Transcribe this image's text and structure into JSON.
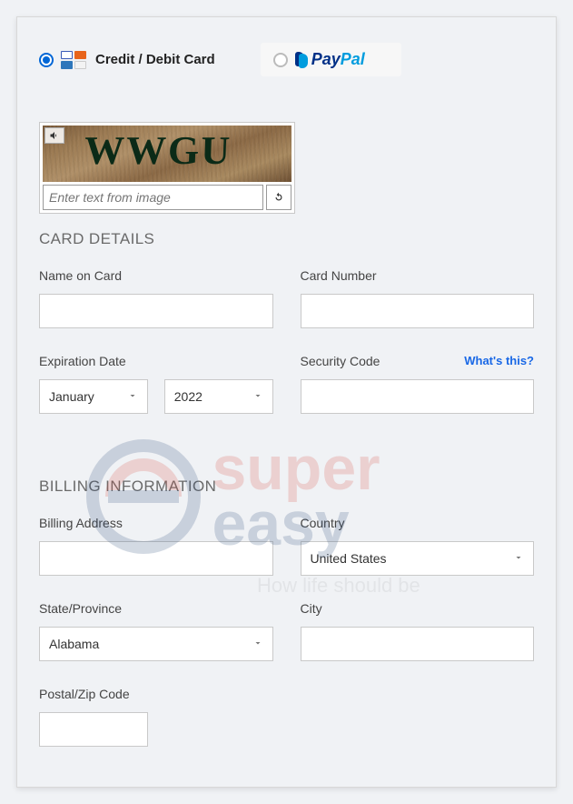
{
  "payment_methods": {
    "card_label": "Credit / Debit Card",
    "paypal_label": "PayPal"
  },
  "captcha": {
    "text": "WWGU",
    "placeholder": "Enter text from image",
    "speaker_icon": "speaker-icon",
    "refresh_icon": "refresh-icon"
  },
  "sections": {
    "card_details": "CARD DETAILS",
    "billing_info": "BILLING INFORMATION"
  },
  "card": {
    "name_label": "Name on Card",
    "number_label": "Card Number",
    "exp_label": "Expiration Date",
    "exp_month": "January",
    "exp_year": "2022",
    "security_label": "Security Code",
    "whats_this": "What's this?"
  },
  "billing": {
    "address_label": "Billing Address",
    "country_label": "Country",
    "country_value": "United States",
    "state_label": "State/Province",
    "state_value": "Alabama",
    "city_label": "City",
    "postal_label": "Postal/Zip Code"
  },
  "watermark": {
    "line1": "super",
    "line2": "easy",
    "tagline": "How life should be"
  }
}
